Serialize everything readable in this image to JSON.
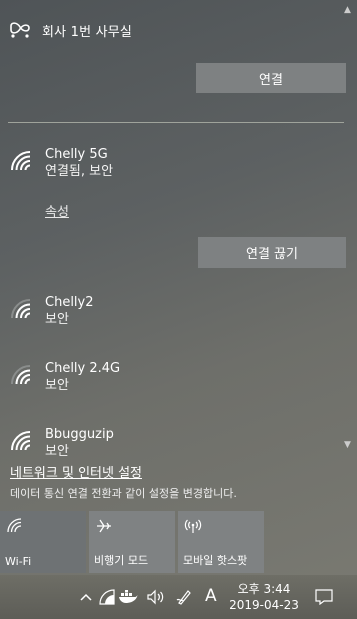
{
  "vpn": {
    "name": "회사 1번 사무실",
    "connect_label": "연결"
  },
  "networks": [
    {
      "name": "Chelly 5G",
      "status": "연결됨, 보안",
      "properties_label": "속성",
      "disconnect_label": "연결 끊기"
    },
    {
      "name": "Chelly2",
      "status": "보안"
    },
    {
      "name": "Chelly 2.4G",
      "status": "보안"
    },
    {
      "name": "Bbugguzip",
      "status": "보안"
    }
  ],
  "settings": {
    "link": "네트워크 및 인터넷 설정",
    "description": "데이터 통신 연결 전환과 같이 설정을 변경합니다."
  },
  "tiles": [
    {
      "label": "Wi-Fi",
      "icon": "wifi-icon"
    },
    {
      "label": "비행기 모드",
      "icon": "airplane-icon"
    },
    {
      "label": "모바일 핫스팟",
      "icon": "hotspot-icon"
    }
  ],
  "taskbar": {
    "input_indicator": "A",
    "time": "오후 3:44",
    "date": "2019-04-23",
    "tray_icons": [
      "chevron-up-icon",
      "network-icon",
      "docker-icon",
      "volume-icon",
      "pen-icon",
      "notification-icon"
    ]
  },
  "colors": {
    "button": "#7e8182",
    "tile": "#7f8283",
    "divider": "#9fa39b"
  }
}
